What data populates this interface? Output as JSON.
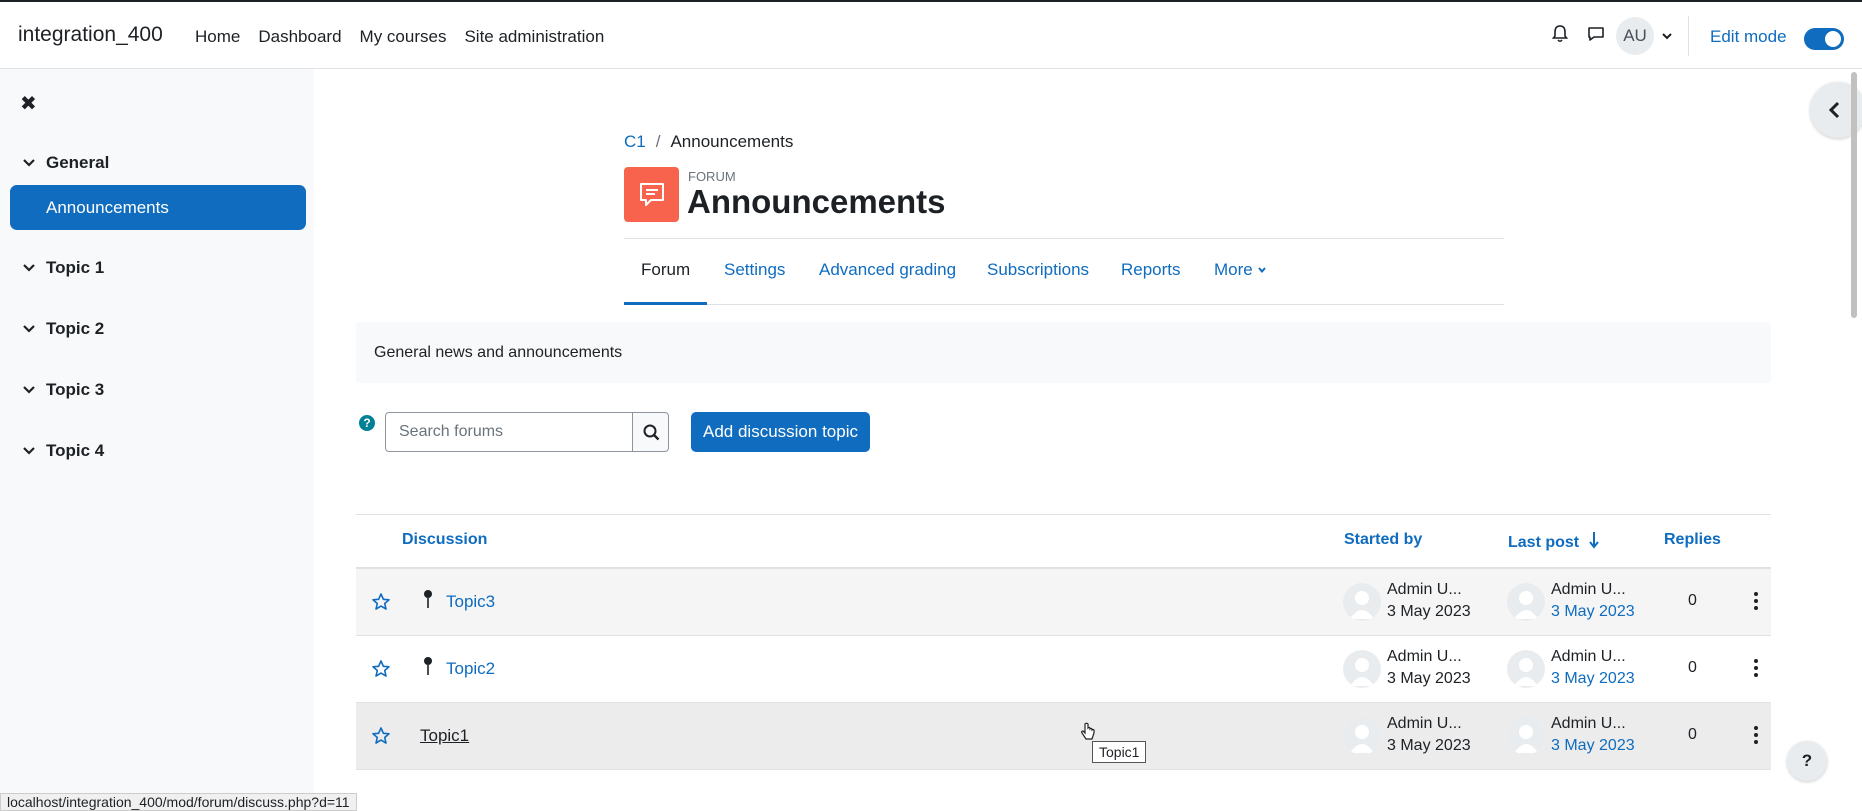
{
  "site": {
    "name": "integration_400"
  },
  "primary_nav": [
    "Home",
    "Dashboard",
    "My courses",
    "Site administration"
  ],
  "user": {
    "initials": "AU"
  },
  "edit_mode": {
    "label": "Edit mode",
    "on": true
  },
  "drawer": {
    "sections": [
      {
        "label": "General",
        "items": [
          "Announcements"
        ]
      },
      {
        "label": "Topic 1"
      },
      {
        "label": "Topic 2"
      },
      {
        "label": "Topic 3"
      },
      {
        "label": "Topic 4"
      }
    ],
    "active_item": "Announcements"
  },
  "breadcrumb": [
    "C1",
    "Announcements"
  ],
  "page": {
    "module_type": "FORUM",
    "title": "Announcements"
  },
  "secondary_nav": {
    "items": [
      "Forum",
      "Settings",
      "Advanced grading",
      "Subscriptions",
      "Reports",
      "More"
    ],
    "active": "Forum"
  },
  "intro": "General news and announcements",
  "search": {
    "placeholder": "Search forums",
    "help": "?"
  },
  "add_button": "Add discussion topic",
  "table": {
    "headers": {
      "discussion": "Discussion",
      "started_by": "Started by",
      "last_post": "Last post",
      "replies": "Replies"
    },
    "rows": [
      {
        "title": "Topic3",
        "pinned": true,
        "started_by": "Admin U...",
        "started_date": "3 May 2023",
        "last_by": "Admin U...",
        "last_date": "3 May 2023",
        "replies": "0"
      },
      {
        "title": "Topic2",
        "pinned": true,
        "started_by": "Admin U...",
        "started_date": "3 May 2023",
        "last_by": "Admin U...",
        "last_date": "3 May 2023",
        "replies": "0"
      },
      {
        "title": "Topic1",
        "pinned": false,
        "started_by": "Admin U...",
        "started_date": "3 May 2023",
        "last_by": "Admin U...",
        "last_date": "3 May 2023",
        "replies": "0"
      }
    ]
  },
  "tooltip": "Topic1",
  "status_url": "localhost/integration_400/mod/forum/discuss.php?d=11",
  "help_bubble": "?",
  "colors": {
    "primary": "#0f6cbf",
    "forum_icon": "#f7634d",
    "help": "#008196"
  }
}
